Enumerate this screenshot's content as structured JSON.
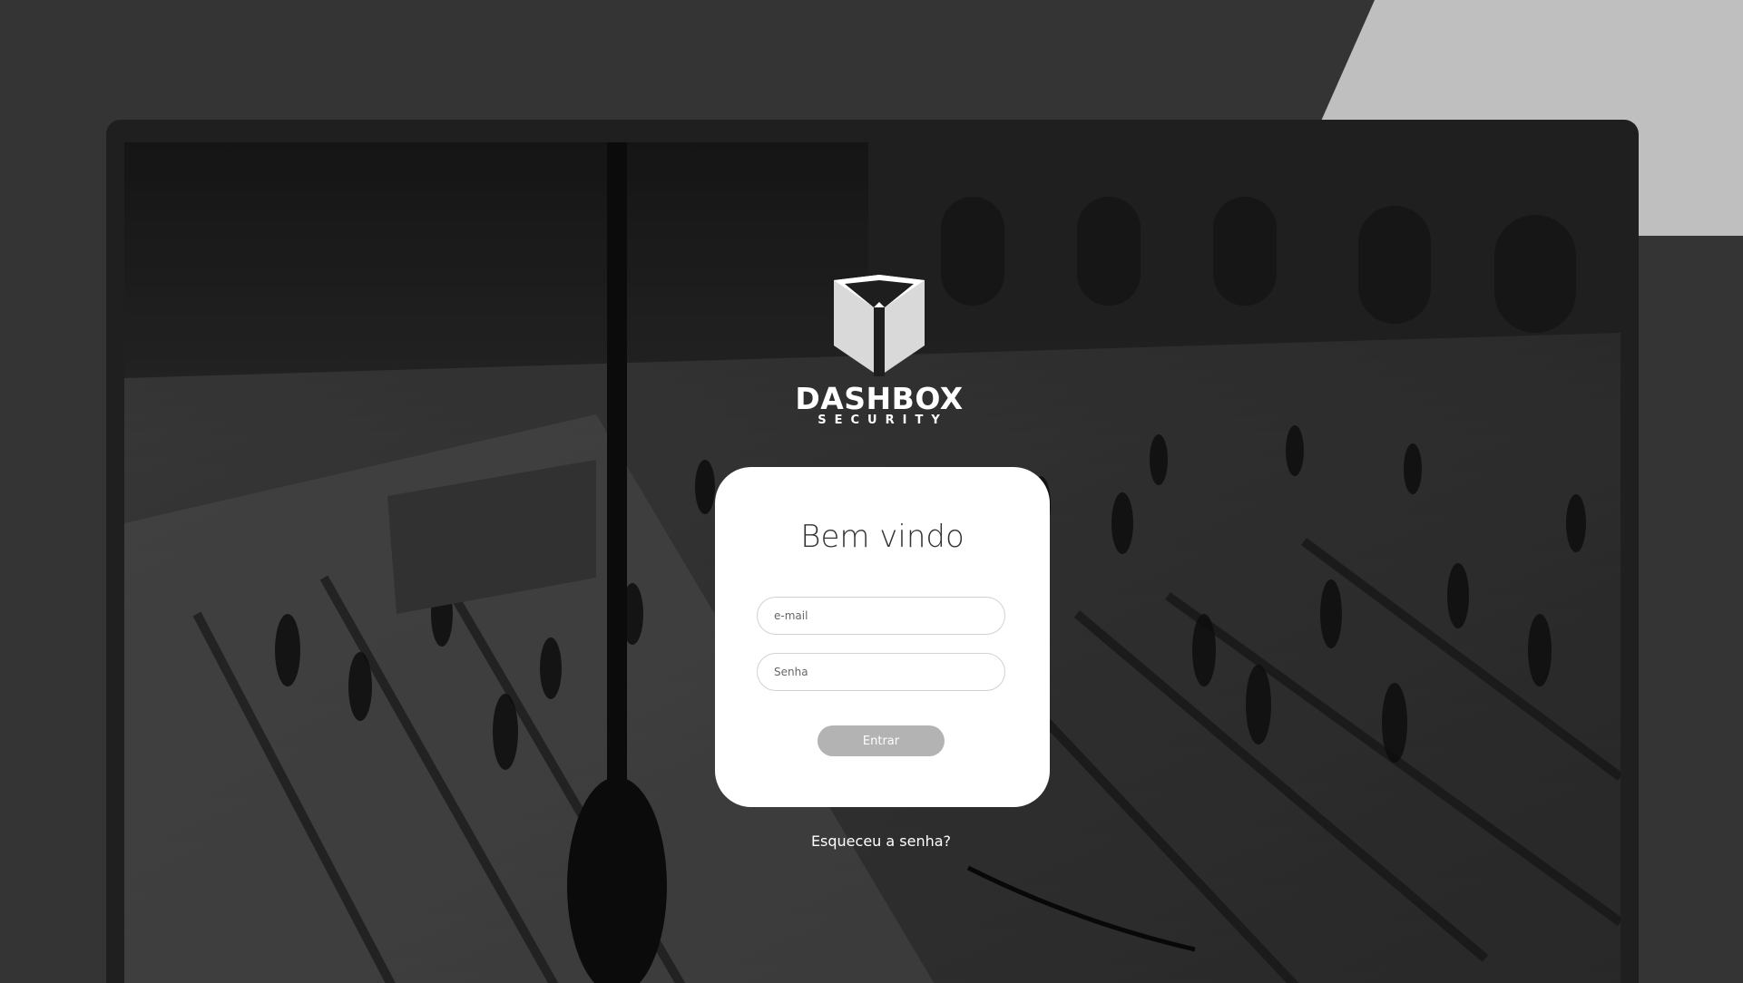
{
  "brand": {
    "name": "DASHBOX",
    "subtitle": "SECURITY"
  },
  "login": {
    "title": "Bem vindo",
    "email_placeholder": "e-mail",
    "password_placeholder": "Senha",
    "submit_label": "Entrar",
    "forgot_label": "Esqueceu a senha?"
  },
  "colors": {
    "background_dark": "#343434",
    "background_light": "#bfbfbf",
    "device_frame": "#1f1f1f",
    "card": "#ffffff",
    "button": "#b3b3b3"
  },
  "icons": {
    "logo": "shield-box-logo"
  }
}
